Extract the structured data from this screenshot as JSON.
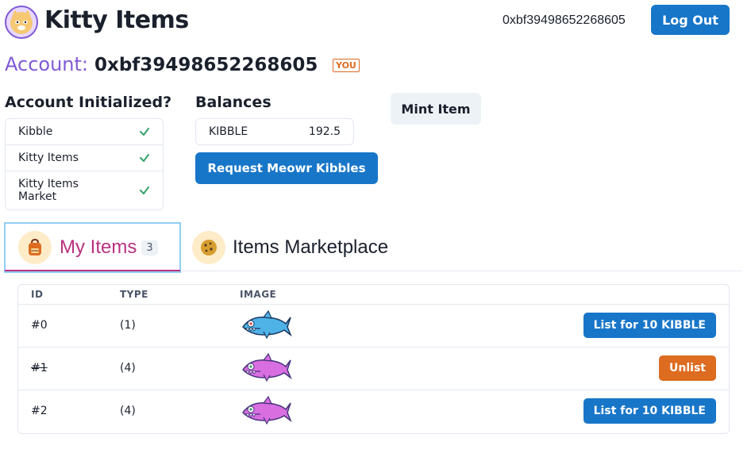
{
  "header": {
    "app_title": "Kitty Items",
    "address": "0xbf39498652268605",
    "logout_label": "Log Out",
    "logo_icon": "kitty-logo-icon"
  },
  "account": {
    "label": "Account:",
    "address": "0xbf39498652268605",
    "you_badge": "YOU"
  },
  "initialized": {
    "title": "Account Initialized?",
    "items": [
      {
        "label": "Kibble",
        "status": "check"
      },
      {
        "label": "Kitty Items",
        "status": "check"
      },
      {
        "label": "Kitty Items Market",
        "status": "check"
      }
    ]
  },
  "balances": {
    "title": "Balances",
    "items": [
      {
        "token": "KIBBLE",
        "amount": "192.5"
      }
    ],
    "request_label": "Request Meowr Kibbles"
  },
  "mint_label": "Mint Item",
  "tabs": {
    "my_items": {
      "label": "My Items",
      "count": "3",
      "icon": "backpack-icon"
    },
    "marketplace": {
      "label": "Items Marketplace",
      "icon": "cookie-icon"
    }
  },
  "table": {
    "headers": [
      "ID",
      "TYPE",
      "IMAGE"
    ],
    "rows": [
      {
        "id": "#0",
        "type": "(1)",
        "image": "blue-shark-image",
        "action": "List for 10 KIBBLE",
        "listed": false
      },
      {
        "id": "#1",
        "type": "(4)",
        "image": "purple-shark-image",
        "action": "Unlist",
        "listed": true
      },
      {
        "id": "#2",
        "type": "(4)",
        "image": "purple-shark-image",
        "action": "List for 10 KIBBLE",
        "listed": false
      }
    ]
  },
  "colors": {
    "primary": "#1876c9",
    "accent_purple": "#805ad5",
    "accent_pink": "#b83280",
    "orange": "#dd6b20",
    "check_green": "#38a169"
  }
}
